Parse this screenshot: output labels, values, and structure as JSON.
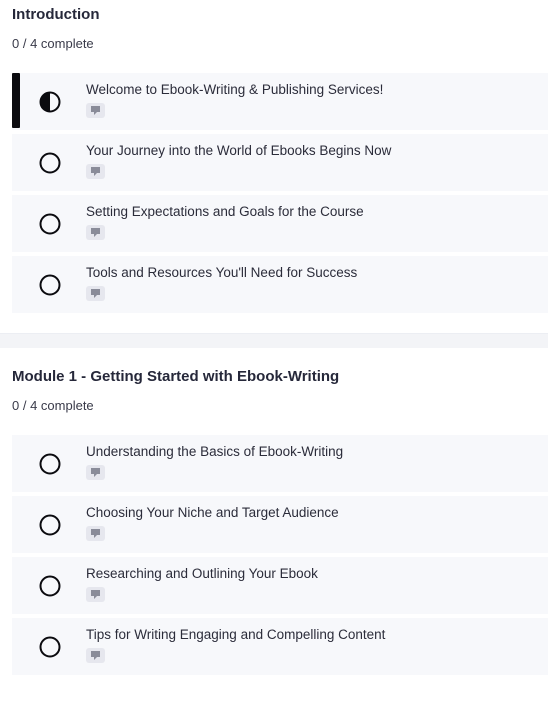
{
  "sections": [
    {
      "title": "Introduction",
      "progress": "0 / 4 complete",
      "lessons": [
        {
          "title": "Welcome to Ebook-Writing & Publishing Services!",
          "status": "in-progress",
          "type_icon": "text-lesson-icon"
        },
        {
          "title": "Your Journey into the World of Ebooks Begins Now",
          "status": "not-started",
          "type_icon": "text-lesson-icon"
        },
        {
          "title": "Setting Expectations and Goals for the Course",
          "status": "not-started",
          "type_icon": "text-lesson-icon"
        },
        {
          "title": "Tools and Resources You'll Need for Success",
          "status": "not-started",
          "type_icon": "text-lesson-icon"
        }
      ]
    },
    {
      "title": "Module 1 - Getting Started with Ebook-Writing",
      "progress": "0 / 4 complete",
      "lessons": [
        {
          "title": "Understanding the Basics of Ebook-Writing",
          "status": "not-started",
          "type_icon": "text-lesson-icon"
        },
        {
          "title": "Choosing Your Niche and Target Audience",
          "status": "not-started",
          "type_icon": "text-lesson-icon"
        },
        {
          "title": "Researching and Outlining Your Ebook",
          "status": "not-started",
          "type_icon": "text-lesson-icon"
        },
        {
          "title": "Tips for Writing Engaging and Compelling Content",
          "status": "not-started",
          "type_icon": "text-lesson-icon"
        }
      ]
    }
  ]
}
